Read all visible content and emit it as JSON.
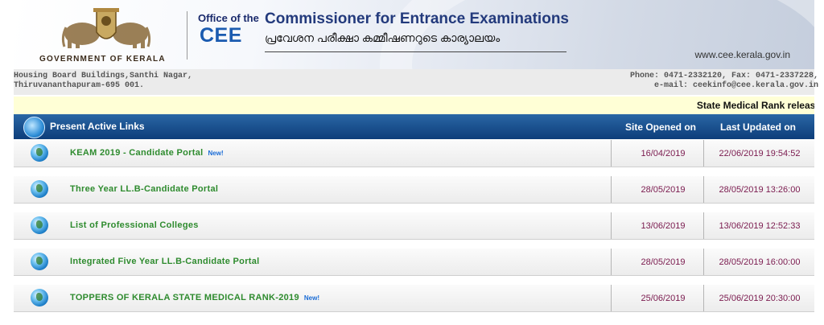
{
  "header": {
    "gov_name": "GOVERNMENT OF KERALA",
    "office_of": "Office of the",
    "cee": "CEE",
    "commissioner_title": "Commissioner for Entrance Examinations",
    "malayalam_title": "പ്രവേശന പരീക്ഷാ കമ്മീഷണറുടെ കാര്യാലയം",
    "website": "www.cee.kerala.gov.in"
  },
  "address": {
    "line1": "Housing Board Buildings,Santhi Nagar,",
    "line2": "Thiruvananthapuram-695 001.",
    "contact1": "Phone: 0471-2332120, Fax: 0471-2337228,",
    "contact2": "e-mail: ceekinfo@cee.kerala.gov.in"
  },
  "ticker": {
    "text": "State Medical Rank release"
  },
  "table": {
    "title": "Present Active Links",
    "col_opened": "Site Opened on",
    "col_updated": "Last Updated on",
    "rows": [
      {
        "label": "KEAM 2019 - Candidate Portal",
        "badge": "New!",
        "opened": "16/04/2019",
        "updated": "22/06/2019 19:54:52"
      },
      {
        "label": "Three Year LL.B-Candidate Portal",
        "badge": "",
        "opened": "28/05/2019",
        "updated": "28/05/2019 13:26:00"
      },
      {
        "label": "List of Professional Colleges",
        "badge": "",
        "opened": "13/06/2019",
        "updated": "13/06/2019 12:52:33"
      },
      {
        "label": "Integrated Five Year LL.B-Candidate Portal",
        "badge": "",
        "opened": "28/05/2019",
        "updated": "28/05/2019 16:00:00"
      },
      {
        "label": "TOPPERS OF KERALA STATE MEDICAL RANK-2019",
        "badge": "New!",
        "opened": "25/06/2019",
        "updated": "25/06/2019 20:30:00"
      }
    ]
  },
  "colors": {
    "header_bar": "#0d3d7a",
    "link_green": "#2e8b2e",
    "date_color": "#7a1a4e",
    "badge_blue": "#1a6cd6",
    "ticker_bg": "#ffffd6"
  },
  "icons": {
    "emblem": "kerala-emblem-icon",
    "header": "globe-arrow-icon",
    "row": "globe-icon"
  }
}
